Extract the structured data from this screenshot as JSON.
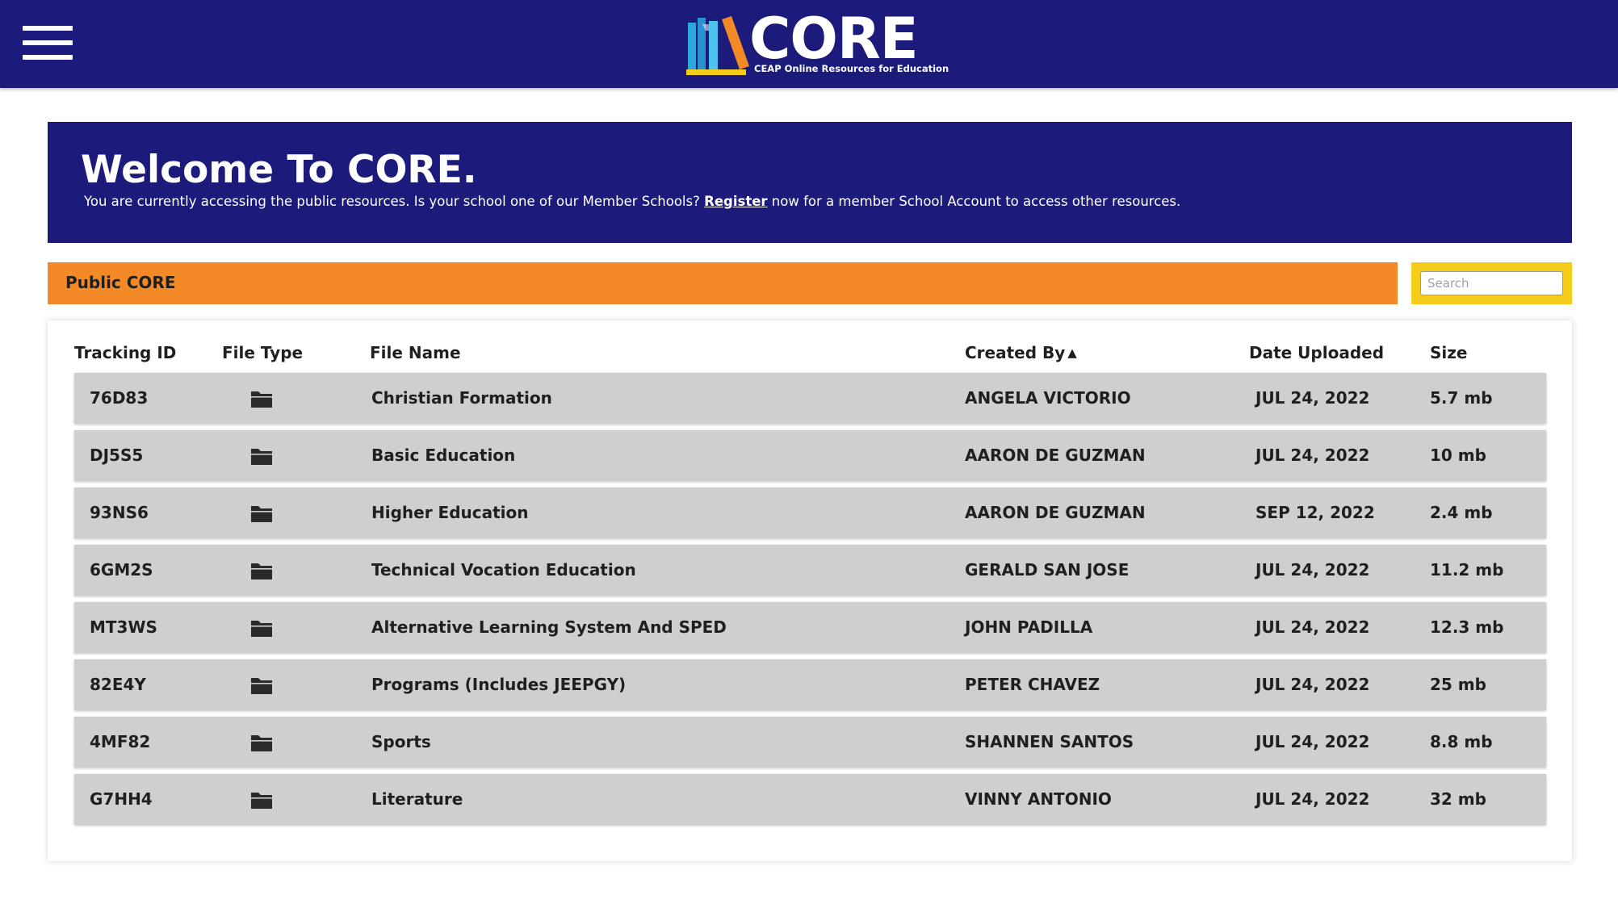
{
  "header": {
    "logo_word": "CORE",
    "logo_tagline": "CEAP Online Resources for Education",
    "menu_icon": "hamburger-menu-icon"
  },
  "welcome": {
    "title": "Welcome To CORE.",
    "text_before": "You are currently accessing the public resources. Is your school one of our Member Schools?",
    "register_link": "Register",
    "text_after": "now for a member School Account to access other resources."
  },
  "section": {
    "title": "Public CORE"
  },
  "search": {
    "placeholder": "Search",
    "value": ""
  },
  "table": {
    "headers": {
      "tracking_id": "Tracking ID",
      "file_type": "File Type",
      "file_name": "File Name",
      "created_by": "Created By",
      "created_by_sort": "▲",
      "date_uploaded": "Date Uploaded",
      "size": "Size"
    },
    "rows": [
      {
        "id": "76D83",
        "icon": "folder-icon",
        "name": "Christian Formation",
        "created_by": "ANGELA VICTORIO",
        "date": "JUL 24, 2022",
        "size": "5.7 mb"
      },
      {
        "id": "DJ5S5",
        "icon": "folder-icon",
        "name": "Basic Education",
        "created_by": "AARON DE GUZMAN",
        "date": "JUL 24, 2022",
        "size": "10 mb"
      },
      {
        "id": "93NS6",
        "icon": "folder-icon",
        "name": "Higher Education",
        "created_by": "AARON DE GUZMAN",
        "date": "SEP 12, 2022",
        "size": "2.4 mb"
      },
      {
        "id": "6GM2S",
        "icon": "folder-icon",
        "name": "Technical Vocation Education",
        "created_by": "GERALD SAN JOSE",
        "date": "JUL 24, 2022",
        "size": "11.2 mb"
      },
      {
        "id": "MT3WS",
        "icon": "folder-icon",
        "name": "Alternative Learning System And SPED",
        "created_by": "JOHN PADILLA",
        "date": "JUL 24, 2022",
        "size": "12.3 mb"
      },
      {
        "id": "82E4Y",
        "icon": "folder-icon",
        "name": "Programs (Includes JEEPGY)",
        "created_by": "PETER CHAVEZ",
        "date": "JUL 24, 2022",
        "size": "25 mb"
      },
      {
        "id": "4MF82",
        "icon": "folder-icon",
        "name": "Sports",
        "created_by": "SHANNEN SANTOS",
        "date": "JUL 24, 2022",
        "size": "8.8 mb"
      },
      {
        "id": "G7HH4",
        "icon": "folder-icon",
        "name": "Literature",
        "created_by": "VINNY ANTONIO",
        "date": "JUL 24, 2022",
        "size": "32 mb"
      }
    ]
  },
  "colors": {
    "navy": "#1c1a7a",
    "orange": "#f48a27",
    "yellow": "#f5cc1a",
    "row_gray": "#cfcfcf",
    "logo_blue": "#2ba8e0",
    "logo_orange": "#f48a27",
    "logo_yellow": "#f5cc1a"
  }
}
